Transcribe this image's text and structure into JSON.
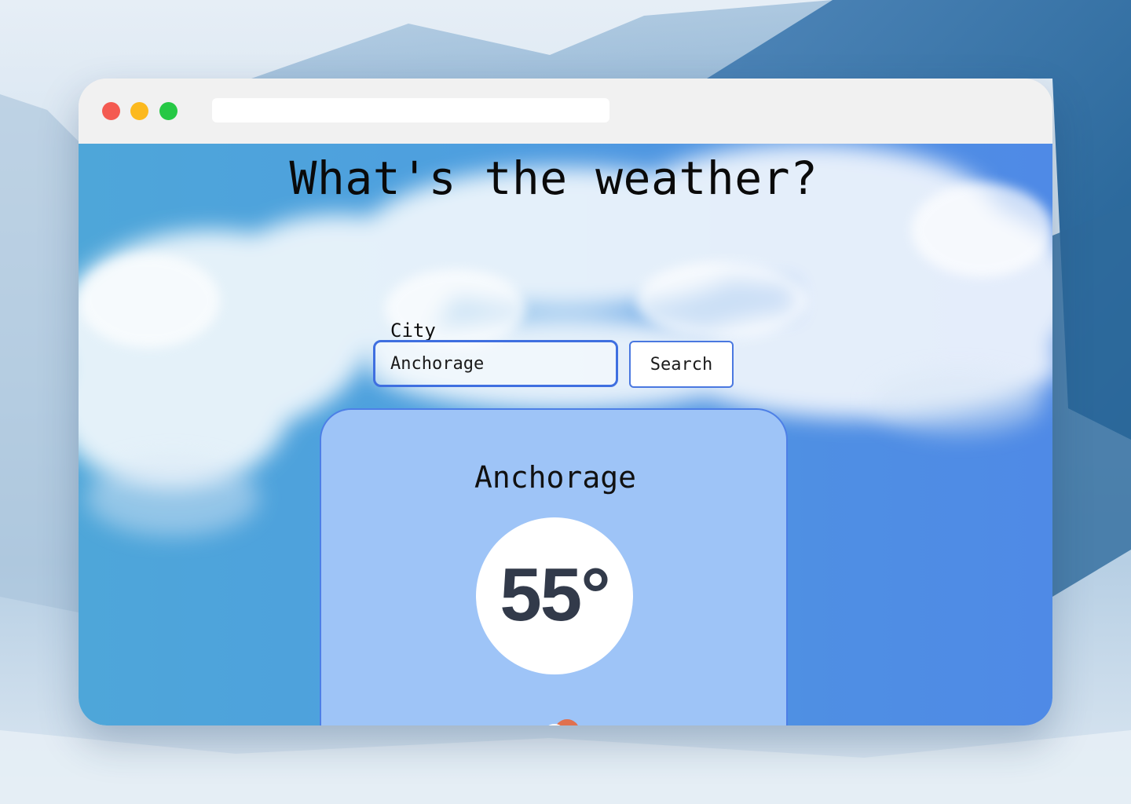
{
  "browser": {
    "address_bar": ""
  },
  "page": {
    "title": "What's the weather?",
    "search": {
      "label": "City",
      "value": "Anchorage",
      "button_label": "Search"
    },
    "weather_card": {
      "city": "Anchorage",
      "temperature": "55°",
      "condition_icon": "cloud-rain-sun-icon"
    }
  },
  "colors": {
    "card_background": "#9ec4f7",
    "accent_border": "#3f6fe0",
    "temperature_text": "#323a4a",
    "traffic_close": "#f45a51",
    "traffic_minimize": "#fcb91e",
    "traffic_maximize": "#26c845"
  }
}
